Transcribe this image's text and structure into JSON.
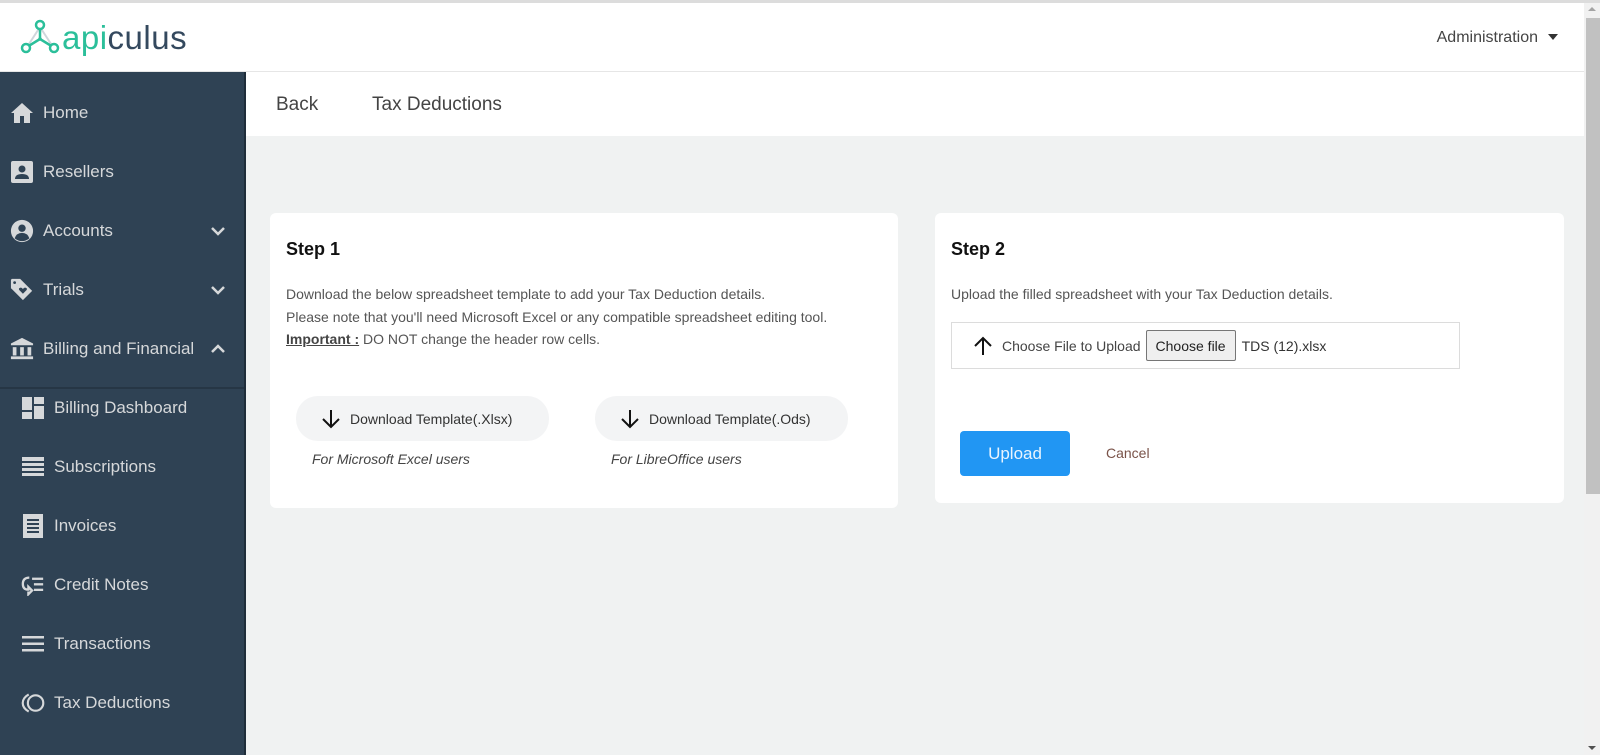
{
  "header": {
    "logo_prefix": "api",
    "logo_suffix": "culus",
    "user_menu_label": "Administration"
  },
  "sidebar": {
    "items": [
      {
        "label": "Home",
        "icon": "home-icon"
      },
      {
        "label": "Resellers",
        "icon": "contact-card-icon"
      },
      {
        "label": "Accounts",
        "icon": "account-circle-icon",
        "expandable": true,
        "expanded": false
      },
      {
        "label": "Trials",
        "icon": "tag-heart-icon",
        "expandable": true,
        "expanded": false
      },
      {
        "label": "Billing and Financial",
        "icon": "bank-icon",
        "expandable": true,
        "expanded": true
      },
      {
        "label": "Billing Dashboard",
        "icon": "dashboard-icon"
      },
      {
        "label": "Subscriptions",
        "icon": "list-icon"
      },
      {
        "label": "Invoices",
        "icon": "receipt-icon"
      },
      {
        "label": "Credit Notes",
        "icon": "credit-note-icon"
      },
      {
        "label": "Transactions",
        "icon": "menu-lines-icon"
      },
      {
        "label": "Tax Deductions",
        "icon": "tax-circle-icon"
      }
    ]
  },
  "subheader": {
    "back_label": "Back",
    "title": "Tax Deductions"
  },
  "step1": {
    "title": "Step 1",
    "line1": "Download the below spreadsheet template to add your Tax Deduction details.",
    "line2": "Please note that you'll need Microsoft Excel or any compatible spreadsheet editing tool.",
    "important_label": "Important :",
    "important_text": " DO NOT change the header row cells.",
    "download_xlsx_label": "Download Template(.Xlsx)",
    "download_xlsx_note": "For Microsoft Excel users",
    "download_ods_label": "Download Template(.Ods)",
    "download_ods_note": "For LibreOffice users"
  },
  "step2": {
    "title": "Step 2",
    "description": "Upload the filled spreadsheet with your Tax Deduction details.",
    "file_label": "Choose File to Upload",
    "choose_button_label": "Choose file",
    "selected_file": "TDS (12).xlsx",
    "upload_label": "Upload",
    "cancel_label": "Cancel"
  },
  "colors": {
    "sidebar_bg": "#2f4254",
    "brand_teal": "#2bbf9a",
    "primary_button": "#2196f3",
    "cancel_text": "#7a5349"
  }
}
